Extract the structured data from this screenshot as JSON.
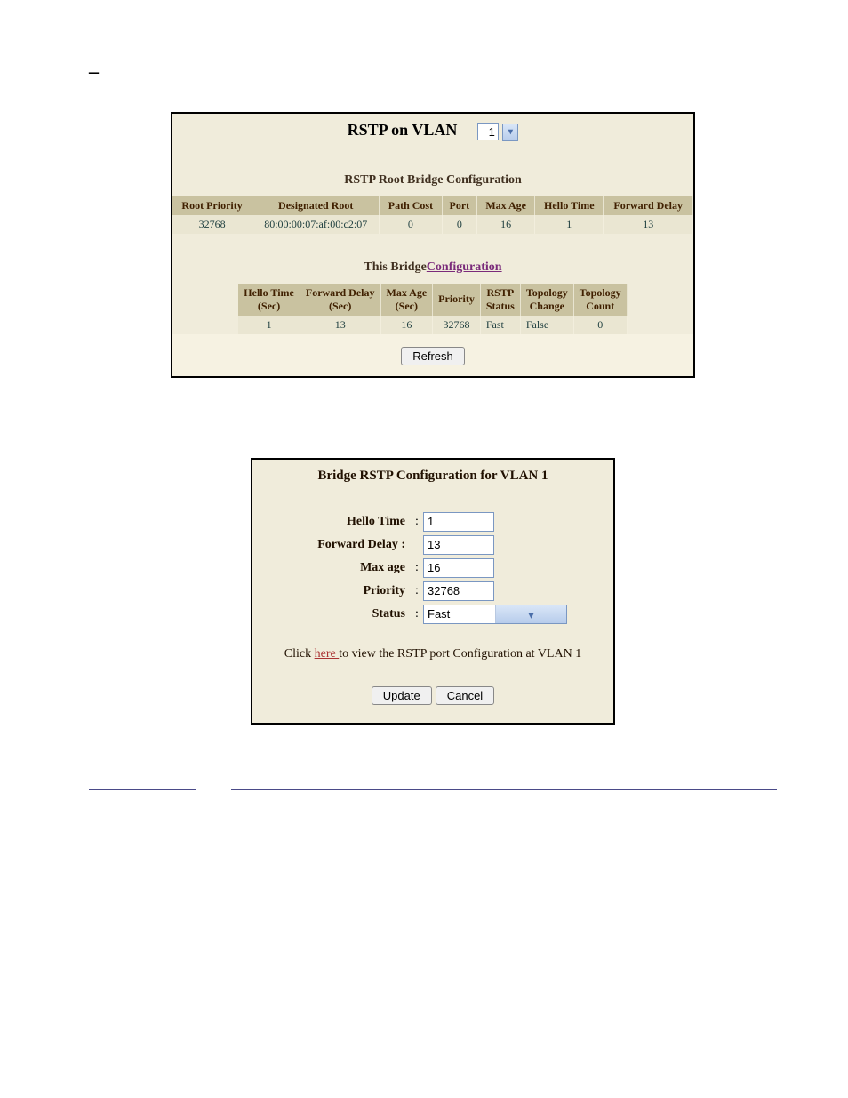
{
  "panel1": {
    "title_prefix": "RSTP on VLAN",
    "vlan_value": "1",
    "section1_title": "RSTP Root Bridge Configuration",
    "table1": {
      "headers": [
        "Root Priority",
        "Designated Root",
        "Path Cost",
        "Port",
        "Max Age",
        "Hello Time",
        "Forward Delay"
      ],
      "row": [
        "32768",
        "80:00:00:07:af:00:c2:07",
        "0",
        "0",
        "16",
        "1",
        "13"
      ]
    },
    "section2_prefix": "This Bridge",
    "section2_link": "Configuration",
    "table2": {
      "headers": [
        "Hello Time\n(Sec)",
        "Forward Delay\n(Sec)",
        "Max Age\n(Sec)",
        "Priority",
        "RSTP\nStatus",
        "Topology\nChange",
        "Topology\nCount"
      ],
      "row": [
        "1",
        "13",
        "16",
        "32768",
        "Fast",
        "False",
        "0"
      ]
    },
    "refresh_label": "Refresh"
  },
  "panel2": {
    "title": "Bridge RSTP Configuration for VLAN 1",
    "fields": {
      "hello_label": "Hello Time",
      "hello_value": "1",
      "fdelay_label": "Forward Delay",
      "fdelay_value": "13",
      "maxage_label": "Max age",
      "maxage_value": "16",
      "priority_label": "Priority",
      "priority_value": "32768",
      "status_label": "Status",
      "status_value": "Fast"
    },
    "hint_pre": "Click ",
    "hint_link": " here ",
    "hint_post": " to view the RSTP port Configuration at VLAN 1",
    "update_label": "Update",
    "cancel_label": "Cancel"
  }
}
